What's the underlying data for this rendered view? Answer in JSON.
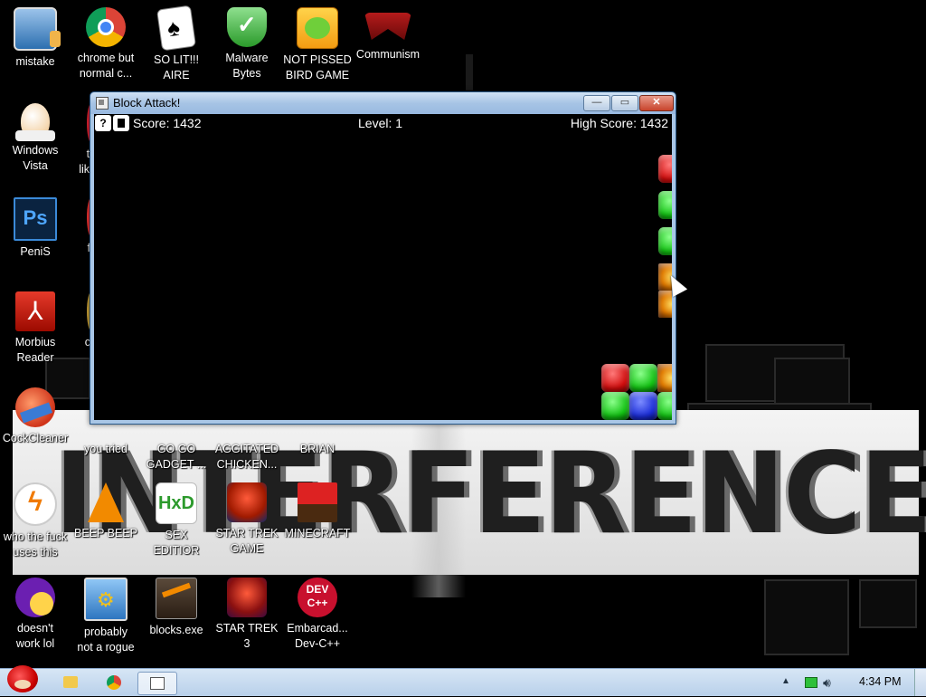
{
  "desktop": {
    "icons": [
      {
        "id": "mistake",
        "lines": [
          "mistake"
        ],
        "icon": "computer-icon"
      },
      {
        "id": "chrome",
        "lines": [
          "chrome but",
          "normal c..."
        ],
        "icon": "chrome-icon"
      },
      {
        "id": "solitaire",
        "lines": [
          "SO LIT!!!",
          "AIRE"
        ],
        "icon": "cards-icon"
      },
      {
        "id": "malware",
        "lines": [
          "Malware",
          "Bytes"
        ],
        "icon": "shield-icon"
      },
      {
        "id": "pissed",
        "lines": [
          "NOT PISSED",
          "BIRD GAME"
        ],
        "icon": "pig-icon"
      },
      {
        "id": "communism",
        "lines": [
          "Communism"
        ],
        "icon": "emblem-icon"
      },
      {
        "id": "vista",
        "lines": [
          "Windows",
          "Vista"
        ],
        "icon": "egg-icon"
      },
      {
        "id": "peni",
        "lines": [
          "PeniS"
        ],
        "icon": "photoshop-icon"
      },
      {
        "id": "reader",
        "lines": [
          "Morbius",
          "Reader"
        ],
        "icon": "pdf-icon"
      },
      {
        "id": "cleaner",
        "lines": [
          "CockCleaner"
        ],
        "icon": "broom-icon"
      },
      {
        "id": "tried",
        "lines": [
          "you tried"
        ],
        "icon": "tried-icon"
      },
      {
        "id": "gadget",
        "lines": [
          "GO GO",
          "GADGET ..."
        ],
        "icon": "gadget-icon"
      },
      {
        "id": "chicken",
        "lines": [
          "AGGITATED",
          "CHICKEN..."
        ],
        "icon": "chicken-icon"
      },
      {
        "id": "brian",
        "lines": [
          "BRIAN"
        ],
        "icon": "brian-icon"
      },
      {
        "id": "who",
        "lines": [
          "who the fuck",
          "uses this"
        ],
        "icon": "lightning-icon"
      },
      {
        "id": "beep",
        "lines": [
          "BEEP BEEP"
        ],
        "icon": "vlc-icon"
      },
      {
        "id": "sex",
        "lines": [
          "SEX",
          "EDITIOR"
        ],
        "icon": "hxd-icon"
      },
      {
        "id": "startrek",
        "lines": [
          "STAR TREK",
          "GAME"
        ],
        "icon": "starwars-bird-icon"
      },
      {
        "id": "minecraft",
        "lines": [
          "MINECRAFT"
        ],
        "icon": "minecraft-icon"
      },
      {
        "id": "yahoo",
        "lines": [
          "doesn't",
          "work lol"
        ],
        "icon": "yahoo-icon"
      },
      {
        "id": "rogue",
        "lines": [
          "probably",
          "not a rogue"
        ],
        "icon": "gears-icon"
      },
      {
        "id": "blocks",
        "lines": [
          "blocks.exe"
        ],
        "icon": "blocks-icon"
      },
      {
        "id": "startrek3",
        "lines": [
          "STAR TREK",
          "3"
        ],
        "icon": "starwars-bird-icon"
      },
      {
        "id": "devcpp",
        "lines": [
          "Embarcad...",
          "Dev-C++"
        ],
        "icon": "devcpp-icon"
      },
      {
        "id": "partial1",
        "lines": [
          "th",
          "like"
        ],
        "icon": "partial-icon"
      },
      {
        "id": "partial2",
        "lines": [
          "f"
        ],
        "icon": "partial-icon"
      },
      {
        "id": "partial3",
        "lines": [
          "c"
        ],
        "icon": "partial-icon"
      }
    ],
    "devcpp_badge": [
      "DEV",
      "C++"
    ],
    "hxd_badge": "HxD",
    "banner_text": "INTERFERENCE"
  },
  "window": {
    "title": "Block Attack!",
    "buttons": {
      "minimize": "—",
      "maximize": "▭",
      "close": "✕"
    },
    "hud": {
      "score": "Score: 1432",
      "level": "Level: 1",
      "high_score": "High Score: 1432",
      "help": "?"
    }
  },
  "taskbar": {
    "clock": "4:34 PM"
  },
  "colors": {
    "taskbar": "#c8dcf0",
    "titlebar": "#a7c4e5",
    "close": "#c8442c"
  }
}
